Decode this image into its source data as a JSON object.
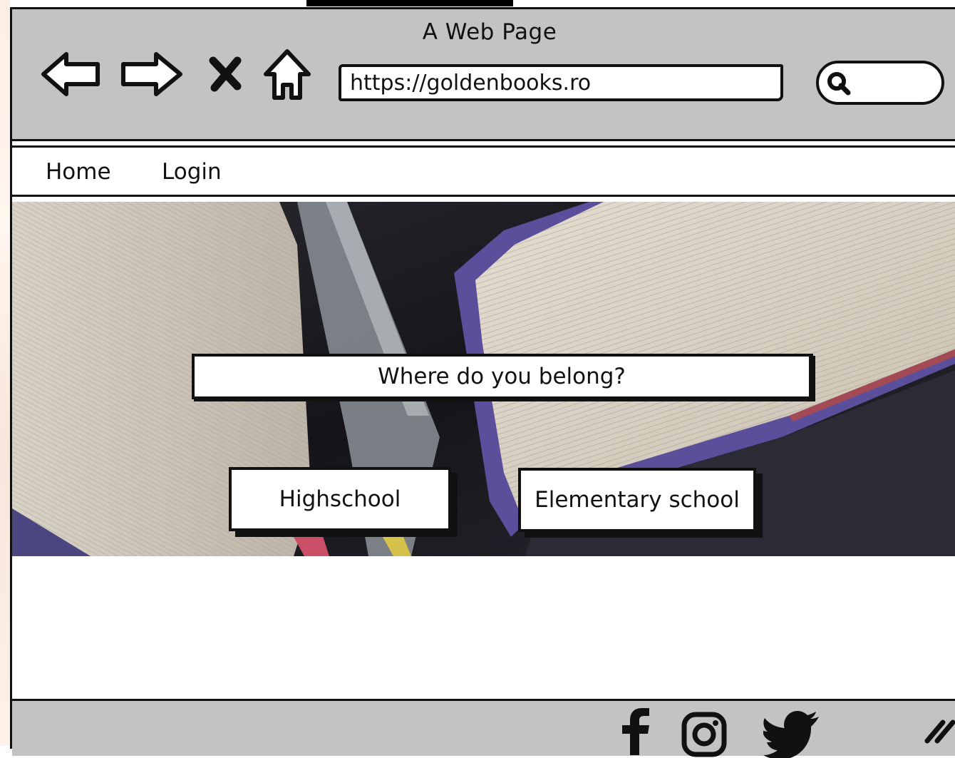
{
  "window": {
    "title": "A Web Page"
  },
  "toolbar": {
    "url": "https://goldenbooks.ro",
    "icons": [
      "back-arrow-icon",
      "forward-arrow-icon",
      "close-icon",
      "home-icon",
      "search-icon"
    ]
  },
  "nav": {
    "items": [
      {
        "label": "Home"
      },
      {
        "label": "Login"
      }
    ]
  },
  "hero": {
    "question": "Where do you belong?",
    "buttons": [
      {
        "label": "Highschool"
      },
      {
        "label": "Elementary school"
      }
    ]
  },
  "footer": {
    "icons": [
      "facebook-icon",
      "instagram-icon",
      "twitter-icon",
      "resize-grip-icon"
    ]
  },
  "colors": {
    "chrome": "#c3c3c3",
    "stroke": "#111111",
    "accent_purple": "#5b4f9c"
  }
}
